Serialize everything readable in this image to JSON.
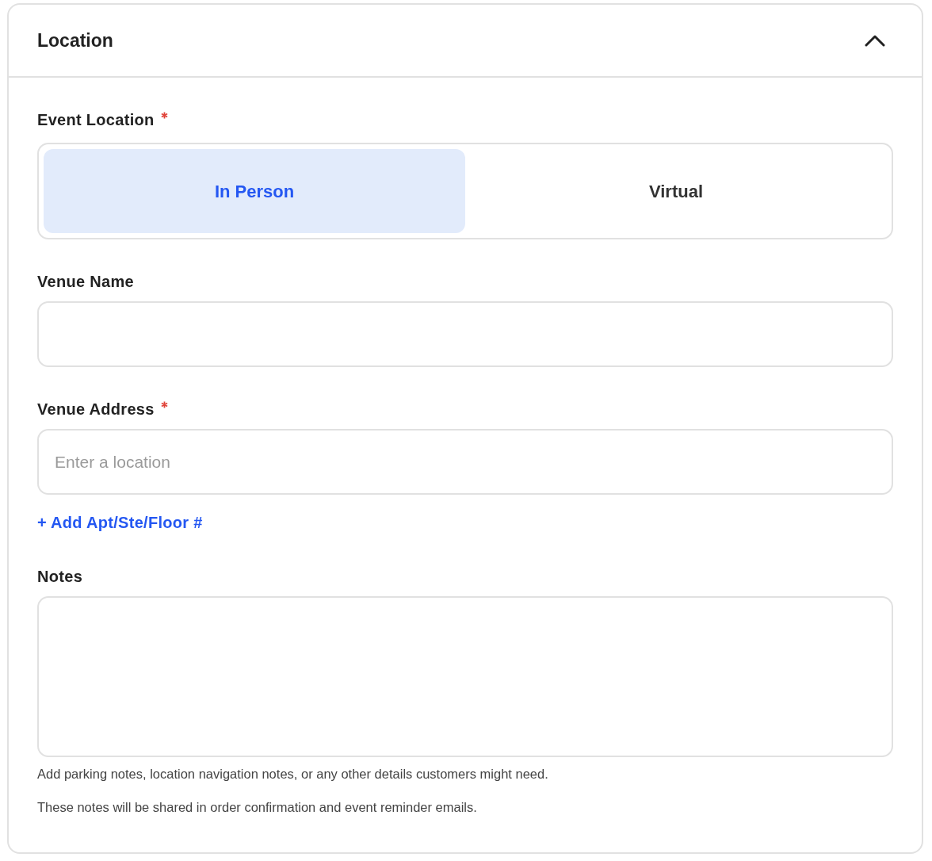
{
  "section": {
    "title": "Location",
    "expanded": true
  },
  "event_location": {
    "label": "Event Location",
    "required": true,
    "options": [
      {
        "label": "In Person",
        "selected": true
      },
      {
        "label": "Virtual",
        "selected": false
      }
    ]
  },
  "fields": [
    {
      "kind": "input",
      "label": "Venue Name"
    },
    {
      "kind": "input",
      "label": "Venue Address",
      "required": true,
      "placeholder": "Enter a location",
      "link": "+ Add Apt/Ste/Floor #"
    },
    {
      "kind": "textarea",
      "label": "Notes",
      "help": [
        "Add parking notes, location navigation notes, or any other details customers might need.",
        "These notes will be shared in order confirmation and event reminder emails."
      ]
    }
  ]
}
